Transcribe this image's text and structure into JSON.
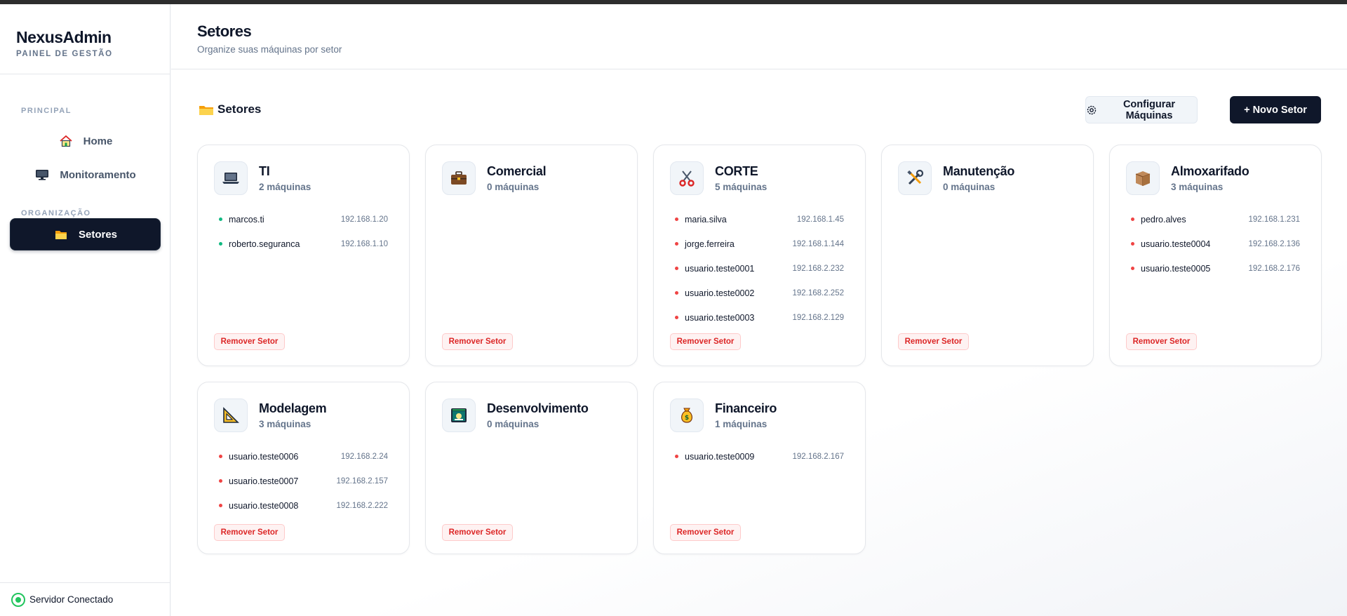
{
  "brand": {
    "name": "NexusAdmin",
    "subtitle": "PAINEL DE GESTÃO"
  },
  "nav": {
    "section_principal": "PRINCIPAL",
    "section_organizacao": "ORGANIZAÇÃO",
    "items": [
      {
        "label": "Home",
        "icon": "house-icon"
      },
      {
        "label": "Monitoramento",
        "icon": "monitor-icon"
      },
      {
        "label": "Setores",
        "icon": "folder-icon",
        "active": true
      }
    ]
  },
  "footer": {
    "status": "Servidor Conectado",
    "status_color": "#22c55e"
  },
  "header": {
    "title": "Setores",
    "subtitle": "Organize suas máquinas por setor"
  },
  "section": {
    "title": "Setores",
    "icon": "folder-icon"
  },
  "actions": {
    "config_label": "Configurar Máquinas",
    "new_label": "+ Novo Setor"
  },
  "colors": {
    "online": "#10b981",
    "offline": "#ef4444",
    "accent": "#0f172a",
    "danger": "#dc2626"
  },
  "remove_label": "Remover Setor",
  "sectors": [
    {
      "name": "TI",
      "count": "2 máquinas",
      "icon": "laptop-icon",
      "machines": [
        {
          "user": "marcos.ti",
          "ip": "192.168.1.20",
          "status": "online"
        },
        {
          "user": "roberto.seguranca",
          "ip": "192.168.1.10",
          "status": "online"
        }
      ]
    },
    {
      "name": "Comercial",
      "count": "0 máquinas",
      "icon": "briefcase-icon",
      "machines": []
    },
    {
      "name": "CORTE",
      "count": "5 máquinas",
      "icon": "scissors-icon",
      "machines": [
        {
          "user": "maria.silva",
          "ip": "192.168.1.45",
          "status": "offline"
        },
        {
          "user": "jorge.ferreira",
          "ip": "192.168.1.144",
          "status": "offline"
        },
        {
          "user": "usuario.teste0001",
          "ip": "192.168.2.232",
          "status": "offline"
        },
        {
          "user": "usuario.teste0002",
          "ip": "192.168.2.252",
          "status": "offline"
        },
        {
          "user": "usuario.teste0003",
          "ip": "192.168.2.129",
          "status": "offline"
        }
      ]
    },
    {
      "name": "Manutenção",
      "count": "0 máquinas",
      "icon": "tools-icon",
      "machines": []
    },
    {
      "name": "Almoxarifado",
      "count": "3 máquinas",
      "icon": "package-icon",
      "machines": [
        {
          "user": "pedro.alves",
          "ip": "192.168.1.231",
          "status": "offline"
        },
        {
          "user": "usuario.teste0004",
          "ip": "192.168.2.136",
          "status": "offline"
        },
        {
          "user": "usuario.teste0005",
          "ip": "192.168.2.176",
          "status": "offline"
        }
      ]
    },
    {
      "name": "Modelagem",
      "count": "3 máquinas",
      "icon": "triangle-ruler-icon",
      "machines": [
        {
          "user": "usuario.teste0006",
          "ip": "192.168.2.24",
          "status": "offline"
        },
        {
          "user": "usuario.teste0007",
          "ip": "192.168.2.157",
          "status": "offline"
        },
        {
          "user": "usuario.teste0008",
          "ip": "192.168.2.222",
          "status": "offline"
        }
      ]
    },
    {
      "name": "Desenvolvimento",
      "count": "0 máquinas",
      "icon": "code-window-icon",
      "machines": []
    },
    {
      "name": "Financeiro",
      "count": "1 máquinas",
      "icon": "money-bag-icon",
      "machines": [
        {
          "user": "usuario.teste0009",
          "ip": "192.168.2.167",
          "status": "offline"
        }
      ]
    }
  ]
}
